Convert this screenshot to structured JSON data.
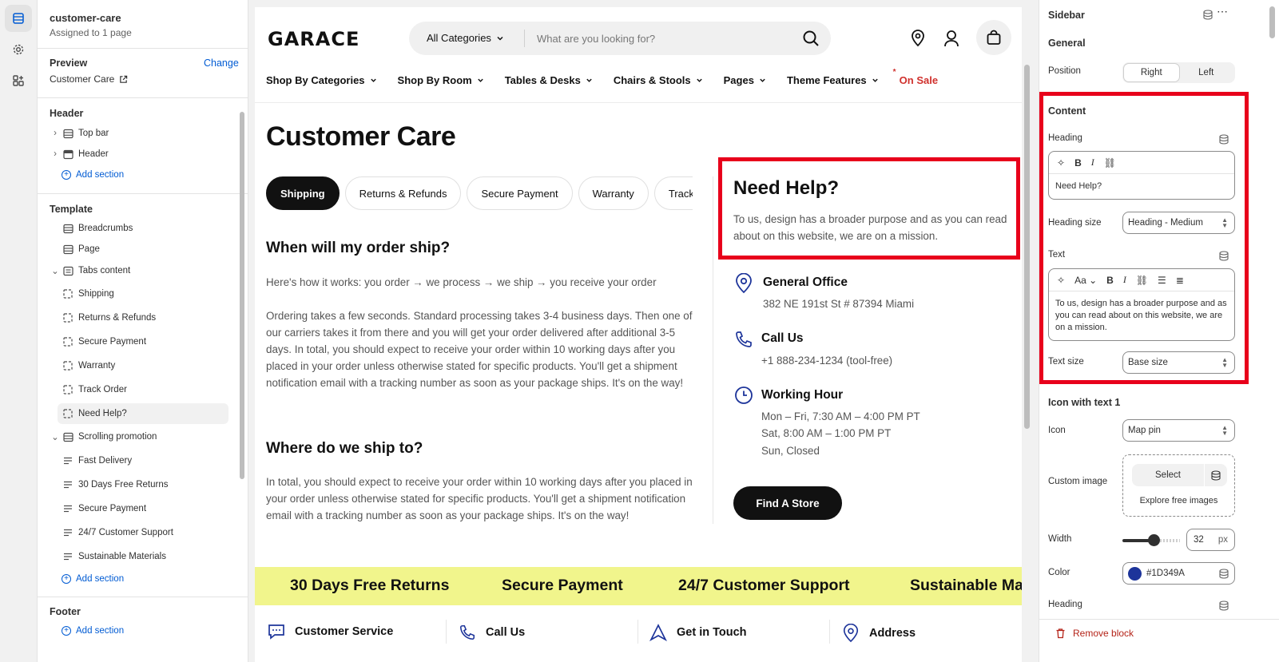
{
  "left_panel": {
    "title": "customer-care",
    "subtitle": "Assigned to 1 page",
    "preview_label": "Preview",
    "preview_change": "Change",
    "preview_value": "Customer Care",
    "header_group": "Header",
    "header_items": [
      "Top bar",
      "Header"
    ],
    "add_section": "Add section",
    "template_group": "Template",
    "template_items": [
      "Breadcrumbs",
      "Page",
      "Tabs content"
    ],
    "tabs_children": [
      "Shipping",
      "Returns & Refunds",
      "Secure Payment",
      "Warranty",
      "Track Order",
      "Need Help?"
    ],
    "scrolling_promotion": "Scrolling promotion",
    "promo_children": [
      "Fast Delivery",
      "30 Days Free Returns",
      "Secure Payment",
      "24/7 Customer Support",
      "Sustainable Materials"
    ],
    "footer_group": "Footer"
  },
  "store": {
    "logo": "GARACE",
    "category_select": "All Categories",
    "search_placeholder": "What are you looking for?",
    "nav": [
      "Shop By Categories",
      "Shop By Room",
      "Tables & Desks",
      "Chairs & Stools",
      "Pages",
      "Theme Features"
    ],
    "nav_sale": "On Sale",
    "page_title": "Customer Care",
    "tabs": [
      "Shipping",
      "Returns & Refunds",
      "Secure Payment",
      "Warranty",
      "Track Order"
    ],
    "q1": "When will my order ship?",
    "p1": "Here's how it works: you order → we process → we ship → you receive your order",
    "p2": "Ordering takes a few seconds. Standard processing takes 3-4 business days. Then one of our carriers takes it from there and you will get your order delivered after additional 3-5 days. In total, you should expect to receive your order within 10 working days after you placed in your order unless otherwise stated for specific products. You'll get a shipment notification email with a tracking number as soon as your package ships. It's on the way!",
    "q2": "Where do we ship to?",
    "p3": "In total, you should expect to receive your order within 10 working days after you placed in your order unless otherwise stated for specific products. You'll get a shipment notification email with a tracking number as soon as your package ships. It's on the way!",
    "help_heading": "Need Help?",
    "help_text": "To us, design has a broader purpose and as you can read about on this website, we are on a mission.",
    "office_title": "General Office",
    "office_text": "382 NE 191st St # 87394 Miami",
    "call_title": "Call Us",
    "call_text": "+1 888-234-1234 (tool-free)",
    "hours_title": "Working Hour",
    "hours_1": "Mon – Fri, 7:30 AM – 4:00 PM PT",
    "hours_2": "Sat, 8:00 AM – 1:00 PM PT",
    "hours_3": "Sun, Closed",
    "find_store": "Find A Store",
    "promo": [
      "30 Days Free Returns",
      "Secure Payment",
      "24/7 Customer Support",
      "Sustainable Ma"
    ],
    "footer_items": [
      "Customer Service",
      "Call Us",
      "Get in Touch",
      "Address"
    ]
  },
  "right_panel": {
    "title": "Sidebar",
    "general": "General",
    "position_label": "Position",
    "position_options": [
      "Right",
      "Left"
    ],
    "content": "Content",
    "heading_label": "Heading",
    "heading_value": "Need Help?",
    "heading_size_label": "Heading size",
    "heading_size_value": "Heading - Medium",
    "text_label": "Text",
    "text_value": "To us, design has a broader purpose and as you can read about on this website, we are on a mission.",
    "text_size_label": "Text size",
    "text_size_value": "Base size",
    "icon_block": "Icon with text 1",
    "icon_label": "Icon",
    "icon_value": "Map pin",
    "custom_image_label": "Custom image",
    "select_button": "Select",
    "explore_images": "Explore free images",
    "width_label": "Width",
    "width_value": "32",
    "width_unit": "px",
    "color_label": "Color",
    "color_value": "#1D349A",
    "heading2_label": "Heading",
    "remove_block": "Remove block"
  },
  "colors": {
    "accent_red": "#e8001b",
    "link_blue": "#005bd3",
    "promo_yellow": "#f1f58c",
    "icon_blue": "#1D349A",
    "sale_red": "#d0312d"
  }
}
